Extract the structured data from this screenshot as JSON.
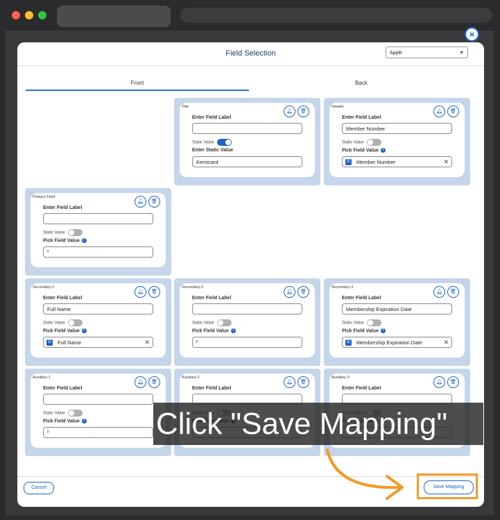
{
  "modal": {
    "title": "Field Selection",
    "select_value": "Apple",
    "close_glyph": "×",
    "tabs": [
      "Front",
      "Back"
    ]
  },
  "common": {
    "enter_field_label": "Enter Field Label",
    "static_value": "Static Value",
    "enter_static_value": "Enter Static Value",
    "pick_field_value": "Pick Field Value"
  },
  "cards": {
    "title": {
      "section": "Title",
      "label_value": "",
      "static_on": true,
      "static_value": "Kemicard"
    },
    "header": {
      "section": "Header",
      "label_value": "Member Number",
      "static_on": false,
      "pick_value": "Member Number"
    },
    "primary": {
      "section": "Primary Field",
      "label_value": "",
      "static_on": false,
      "pick_value": ""
    },
    "secondary1": {
      "section": "Secondary-1",
      "label_value": "Full Name",
      "static_on": false,
      "pick_value": "Full Name"
    },
    "secondary2": {
      "section": "Secondary-2",
      "label_value": "",
      "static_on": false,
      "pick_value": ""
    },
    "secondary3": {
      "section": "Secondary-3",
      "label_value": "Membership Expiration Date",
      "static_on": false,
      "pick_value": "Membership Expiration Date"
    },
    "auxiliary1": {
      "section": "Auxiliary-1",
      "label_value": "",
      "static_on": false,
      "pick_value": ""
    },
    "auxiliary2": {
      "section": "Auxiliary-2",
      "label_value": "",
      "static_on": false,
      "pick_value": ""
    },
    "auxiliary3": {
      "section": "Auxiliary-3",
      "label_value": "",
      "static_on": false,
      "pick_value": ""
    }
  },
  "footer": {
    "cancel_label": "Cancel",
    "save_label": "Save Mapping"
  },
  "overlay": {
    "instruction": "Click \"Save Mapping\""
  },
  "colors": {
    "accent": "#1f62c9",
    "card_background": "#c5d6ea",
    "highlight": "#f29a26"
  },
  "icons": {
    "bell": "bell-icon",
    "trash": "trash-icon",
    "search": "search-icon",
    "field": "field-list-icon",
    "clear": "clear-icon",
    "close": "close-icon",
    "dropdown": "chevron-down-icon"
  }
}
